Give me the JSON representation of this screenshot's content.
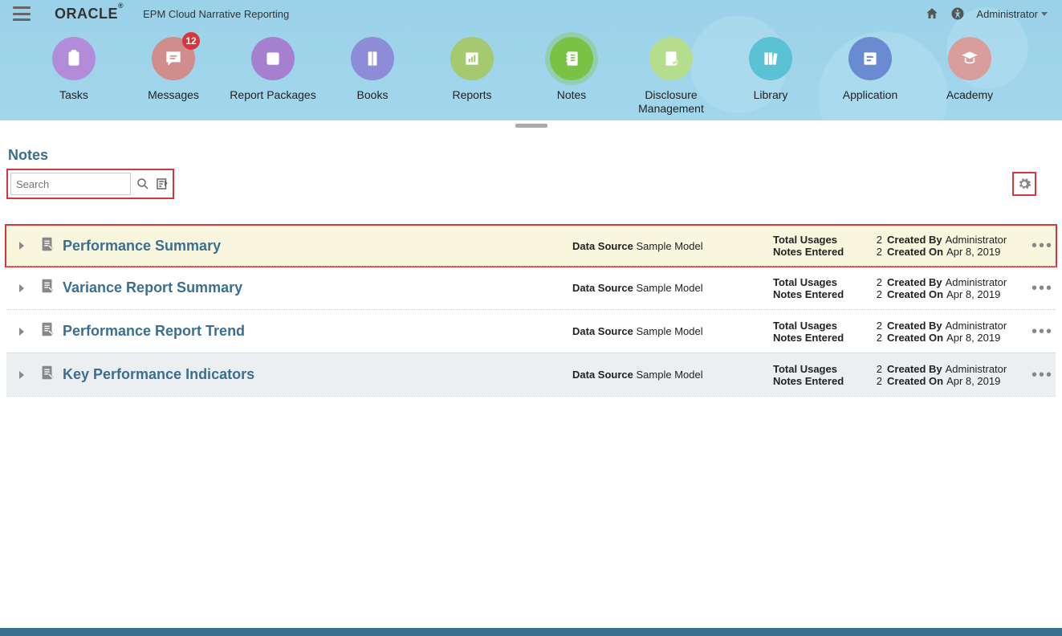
{
  "header": {
    "brand": "ORACLE",
    "product": "EPM Cloud Narrative Reporting",
    "user": "Administrator"
  },
  "nav": {
    "items": [
      {
        "label": "Tasks",
        "color": "#b28cd9",
        "icon": "clipboard"
      },
      {
        "label": "Messages",
        "color": "#d18c8c",
        "icon": "chat",
        "badge": "12"
      },
      {
        "label": "Report Packages",
        "color": "#a67fd1",
        "icon": "package"
      },
      {
        "label": "Books",
        "color": "#8c8cd9",
        "icon": "book"
      },
      {
        "label": "Reports",
        "color": "#a4c96f",
        "icon": "report"
      },
      {
        "label": "Notes",
        "color": "#7ac246",
        "icon": "notes",
        "active": true
      },
      {
        "label": "Disclosure\nManagement",
        "color": "#b6dd8e",
        "icon": "disclosure"
      },
      {
        "label": "Library",
        "color": "#5bc2d6",
        "icon": "library"
      },
      {
        "label": "Application",
        "color": "#6a8bd1",
        "icon": "app"
      },
      {
        "label": "Academy",
        "color": "#d99d9d",
        "icon": "academy"
      }
    ]
  },
  "page": {
    "title": "Notes",
    "search_placeholder": "Search"
  },
  "labels": {
    "data_source": "Data Source",
    "total_usages": "Total Usages",
    "notes_entered": "Notes Entered",
    "created_by": "Created By",
    "created_on": "Created On"
  },
  "notes": [
    {
      "title": "Performance Summary",
      "data_source": "Sample Model",
      "total_usages": "2",
      "notes_entered": "2",
      "created_by": "Administrator",
      "created_on": "Apr 8, 2019",
      "selected": true,
      "highlighted": true
    },
    {
      "title": "Variance Report Summary",
      "data_source": "Sample Model",
      "total_usages": "2",
      "notes_entered": "2",
      "created_by": "Administrator",
      "created_on": "Apr 8, 2019"
    },
    {
      "title": "Performance Report Trend",
      "data_source": "Sample Model",
      "total_usages": "2",
      "notes_entered": "2",
      "created_by": "Administrator",
      "created_on": "Apr 8, 2019"
    },
    {
      "title": "Key Performance Indicators",
      "data_source": "Sample Model",
      "total_usages": "2",
      "notes_entered": "2",
      "created_by": "Administrator",
      "created_on": "Apr 8, 2019",
      "alt": true
    }
  ]
}
